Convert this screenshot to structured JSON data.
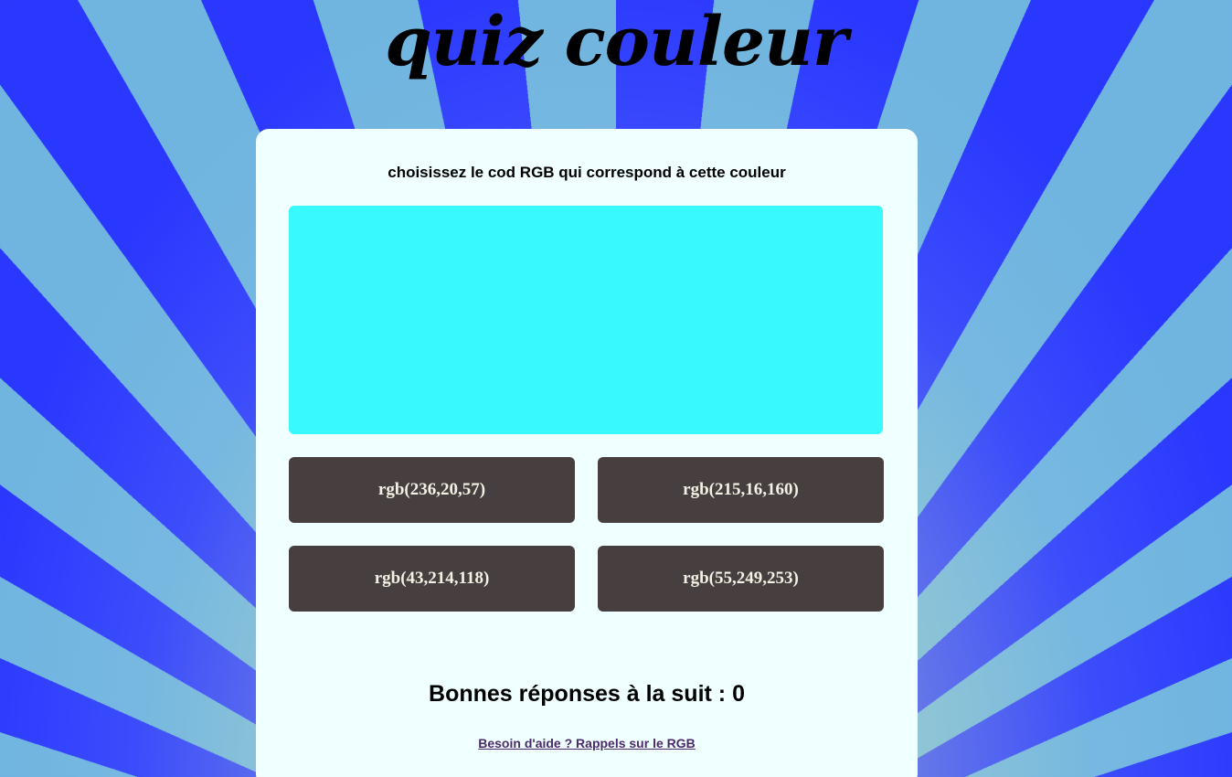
{
  "header": {
    "title": "quiz couleur"
  },
  "quiz": {
    "instruction": "choisissez le cod RGB qui correspond à cette couleur",
    "swatch_color": "#38f9fd",
    "options": [
      {
        "label": "rgb(236,20,57)"
      },
      {
        "label": "rgb(215,16,160)"
      },
      {
        "label": "rgb(43,214,118)"
      },
      {
        "label": "rgb(55,249,253)"
      }
    ],
    "score_text": "Bonnes réponses à la suit : 0",
    "help_link": "Besoin d'aide ? Rappels sur le RGB"
  },
  "colors": {
    "button_bg": "#473f3f",
    "button_text": "#f3f0e4",
    "card_bg": "#f0ffff",
    "ray_blue": "#2a37ff",
    "ray_light": "#6fb5e0"
  }
}
